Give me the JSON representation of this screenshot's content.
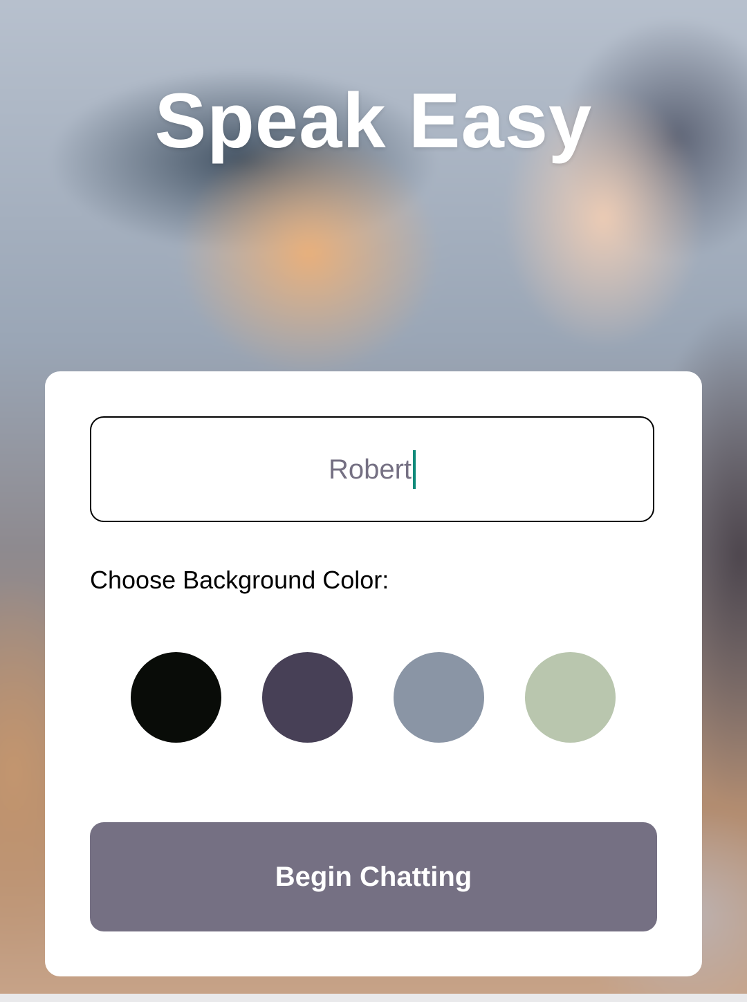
{
  "app": {
    "title": "Speak Easy"
  },
  "form": {
    "name_value": "Robert",
    "color_label": "Choose Background Color:",
    "colors": [
      {
        "name": "black",
        "hex": "#090C08"
      },
      {
        "name": "purple",
        "hex": "#474056"
      },
      {
        "name": "blue-gray",
        "hex": "#8A95A5"
      },
      {
        "name": "sage",
        "hex": "#B9C6AE"
      }
    ],
    "submit_label": "Begin Chatting",
    "submit_color": "#757083"
  }
}
